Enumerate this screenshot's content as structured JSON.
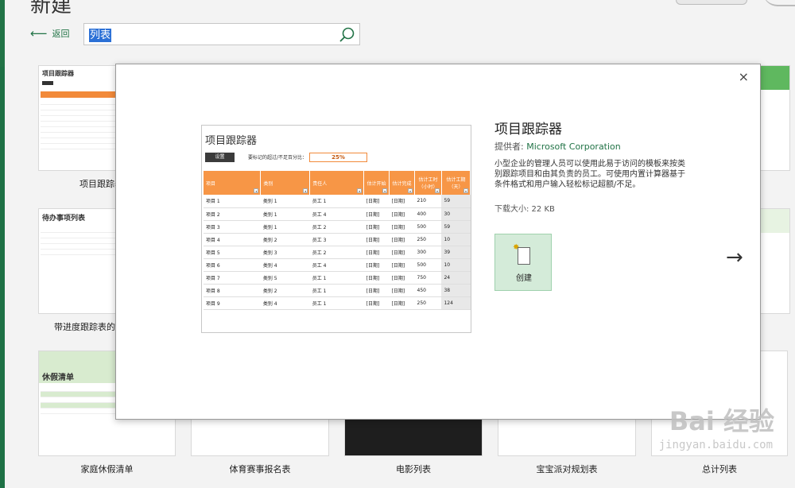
{
  "page": {
    "title": "新建"
  },
  "nav": {
    "back_label": "返回"
  },
  "search": {
    "value": "列表",
    "placeholder": ""
  },
  "templates": [
    {
      "label": "项目跟踪器",
      "thumb_title": "项目跟踪器"
    },
    {
      "label": "带进度跟踪表的待办事项列表",
      "thumb_title": "待办事项列表"
    },
    {
      "label": "家庭休假清单",
      "thumb_title": "休假清单"
    },
    {
      "label": "体育赛事报名表"
    },
    {
      "label": "电影列表"
    },
    {
      "label": "宝宝派对规划表"
    },
    {
      "label": "总计列表"
    }
  ],
  "detail": {
    "title": "项目跟踪器",
    "provider_label": "提供者:",
    "provider": "Microsoft Corporation",
    "description": "小型企业的管理人员可以使用此易于访问的模板来按类别跟踪项目和由其负责的员工。可使用内置计算器基于条件格式和用户输入轻松标记超额/不足。",
    "size": "下载大小: 22 KB",
    "create_label": "创建",
    "close_glyph": "×",
    "next_glyph": "→"
  },
  "preview": {
    "title": "项目跟踪器",
    "button": "设置",
    "note": "要标记的超过/不足百分比：",
    "percent": "25%",
    "headers": [
      "项目",
      "类别",
      "责任人",
      "估计开始",
      "估计完成",
      "估计工时（小时）",
      "估计工期（天）"
    ],
    "rows": [
      [
        "项目 1",
        "类别 1",
        "员工 1",
        "[日期]",
        "[日期]",
        "210",
        "59"
      ],
      [
        "项目 2",
        "类别 1",
        "员工 4",
        "[日期]",
        "[日期]",
        "400",
        "30"
      ],
      [
        "项目 3",
        "类别 1",
        "员工 2",
        "[日期]",
        "[日期]",
        "500",
        "59"
      ],
      [
        "项目 4",
        "类别 2",
        "员工 3",
        "[日期]",
        "[日期]",
        "250",
        "10"
      ],
      [
        "项目 5",
        "类别 3",
        "员工 2",
        "[日期]",
        "[日期]",
        "300",
        "39"
      ],
      [
        "项目 6",
        "类别 4",
        "员工 4",
        "[日期]",
        "[日期]",
        "500",
        "10"
      ],
      [
        "项目 7",
        "类别 5",
        "员工 1",
        "[日期]",
        "[日期]",
        "750",
        "24"
      ],
      [
        "项目 8",
        "类别 2",
        "员工 1",
        "[日期]",
        "[日期]",
        "450",
        "38"
      ],
      [
        "项目 9",
        "类别 4",
        "员工 1",
        "[日期]",
        "[日期]",
        "250",
        "124"
      ]
    ]
  },
  "watermark": {
    "brand": "Bai 经验",
    "url": "jingyan.baidu.com"
  },
  "colors": {
    "accent": "#217346",
    "orange": "#f79646"
  }
}
